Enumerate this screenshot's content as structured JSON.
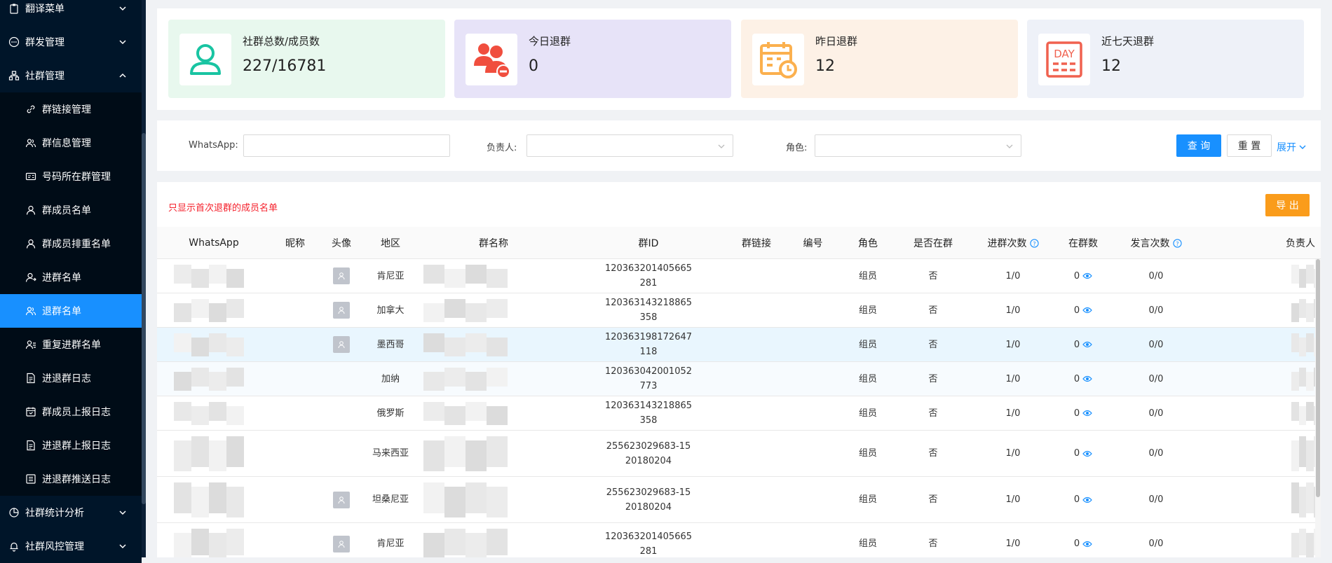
{
  "sidebar": {
    "items": [
      {
        "label": "翻译菜单",
        "icon": "clipboard-icon",
        "type": "top"
      },
      {
        "label": "群发管理",
        "icon": "chat-dots-icon",
        "type": "top"
      },
      {
        "label": "社群管理",
        "icon": "org-chart-icon",
        "type": "top-open"
      },
      {
        "label": "群链接管理",
        "icon": "link-icon",
        "type": "sub"
      },
      {
        "label": "群信息管理",
        "icon": "users-icon",
        "type": "sub"
      },
      {
        "label": "号码所在群管理",
        "icon": "id-card-icon",
        "type": "sub"
      },
      {
        "label": "群成员名单",
        "icon": "user-icon",
        "type": "sub"
      },
      {
        "label": "群成员排重名单",
        "icon": "user-icon",
        "type": "sub"
      },
      {
        "label": "进群名单",
        "icon": "user-enter-icon",
        "type": "sub"
      },
      {
        "label": "退群名单",
        "icon": "users-icon",
        "type": "sub-active"
      },
      {
        "label": "重复进群名单",
        "icon": "user-list-icon",
        "type": "sub"
      },
      {
        "label": "进退群日志",
        "icon": "document-icon",
        "type": "sub"
      },
      {
        "label": "群成员上报日志",
        "icon": "calendar-icon",
        "type": "sub"
      },
      {
        "label": "进退群上报日志",
        "icon": "document-icon",
        "type": "sub"
      },
      {
        "label": "进退群推送日志",
        "icon": "list-icon",
        "type": "sub"
      },
      {
        "label": "社群统计分析",
        "icon": "pie-chart-icon",
        "type": "top"
      },
      {
        "label": "社群风控管理",
        "icon": "bell-icon",
        "type": "top"
      }
    ]
  },
  "stats": [
    {
      "label": "社群总数/成员数",
      "value": "227/16781",
      "bg": "#e8f8ee",
      "icon": "user-outline-icon",
      "color": "#19c4a2"
    },
    {
      "label": "今日退群",
      "value": "0",
      "bg": "#e7e3f8",
      "icon": "users-remove-icon",
      "color": "#f04e3e"
    },
    {
      "label": "昨日退群",
      "value": "12",
      "bg": "#fdf1e6",
      "icon": "calendar-clock-icon",
      "color": "#fbb04e"
    },
    {
      "label": "近七天退群",
      "value": "12",
      "bg": "#eef1f8",
      "icon": "day-calendar-icon",
      "color": "#f0614f",
      "icon_text": "DAY"
    }
  ],
  "filters": {
    "whatsapp_label": "WhatsApp:",
    "whatsapp_value": "",
    "owner_label": "负责人:",
    "owner_value": "",
    "role_label": "角色:",
    "role_value": "",
    "search_label": "查 询",
    "reset_label": "重 置",
    "expand_label": "展开"
  },
  "table": {
    "notice": "只显示首次退群的成员名单",
    "export_label": "导 出",
    "columns": [
      "WhatsApp",
      "昵称",
      "头像",
      "地区",
      "群名称",
      "群ID",
      "群链接",
      "编号",
      "角色",
      "是否在群",
      "进群次数",
      "在群数",
      "发言次数",
      "负责人"
    ],
    "rows": [
      {
        "avatar": true,
        "region": "肯尼亚",
        "group_id": "120363201405665281",
        "role": "组员",
        "in_group": "否",
        "join_count": "1/0",
        "group_count": "0",
        "speak_count": "0/0"
      },
      {
        "avatar": true,
        "region": "加拿大",
        "group_id": "120363143218865358",
        "role": "组员",
        "in_group": "否",
        "join_count": "1/0",
        "group_count": "0",
        "speak_count": "0/0"
      },
      {
        "avatar": true,
        "region": "墨西哥",
        "group_id": "120363198172647118",
        "role": "组员",
        "in_group": "否",
        "join_count": "1/0",
        "group_count": "0",
        "speak_count": "0/0"
      },
      {
        "avatar": false,
        "region": "加纳",
        "group_id": "120363042001052773",
        "role": "组员",
        "in_group": "否",
        "join_count": "1/0",
        "group_count": "0",
        "speak_count": "0/0"
      },
      {
        "avatar": false,
        "region": "俄罗斯",
        "group_id": "120363143218865358",
        "role": "组员",
        "in_group": "否",
        "join_count": "1/0",
        "group_count": "0",
        "speak_count": "0/0"
      },
      {
        "avatar": false,
        "region": "马来西亚",
        "group_id": "255623029683-1520180204",
        "role": "组员",
        "in_group": "否",
        "join_count": "1/0",
        "group_count": "0",
        "speak_count": "0/0"
      },
      {
        "avatar": true,
        "region": "坦桑尼亚",
        "group_id": "255623029683-1520180204",
        "role": "组员",
        "in_group": "否",
        "join_count": "1/0",
        "group_count": "0",
        "speak_count": "0/0"
      },
      {
        "avatar": true,
        "region": "肯尼亚",
        "group_id": "120363201405665281",
        "role": "组员",
        "in_group": "否",
        "join_count": "1/0",
        "group_count": "0",
        "speak_count": "0/0"
      }
    ]
  },
  "colors": {
    "sidebar_bg": "#001529",
    "submenu_bg": "#000c17",
    "active": "#1890ff",
    "export": "#fa9c1b",
    "notice": "#f5222d"
  }
}
